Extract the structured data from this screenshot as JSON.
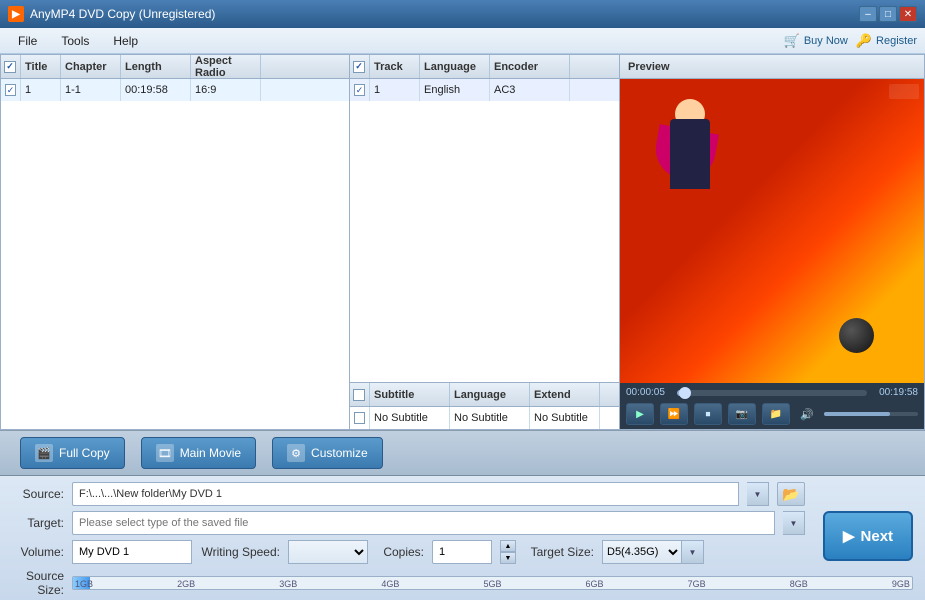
{
  "titleBar": {
    "appName": "AnyMP4 DVD Copy (Unregistered)",
    "minBtn": "–",
    "maxBtn": "□",
    "closeBtn": "✕"
  },
  "menuBar": {
    "items": [
      "File",
      "Tools",
      "Help"
    ]
  },
  "topActions": {
    "buyLabel": "Buy Now",
    "registerLabel": "Register"
  },
  "mainTable": {
    "headers": [
      {
        "label": "",
        "check": true
      },
      {
        "label": "Title"
      },
      {
        "label": "Chapter"
      },
      {
        "label": "Length"
      },
      {
        "label": "Aspect Radio"
      }
    ],
    "rows": [
      {
        "check": true,
        "title": "1",
        "chapter": "1-1",
        "length": "00:19:58",
        "aspect": "16:9"
      }
    ]
  },
  "audioTable": {
    "headers": [
      {
        "label": "",
        "check": true
      },
      {
        "label": "Track"
      },
      {
        "label": "Language"
      },
      {
        "label": "Encoder"
      }
    ],
    "rows": [
      {
        "check": true,
        "track": "1",
        "language": "English",
        "encoder": "AC3"
      }
    ]
  },
  "subtitleTable": {
    "headers": [
      {
        "label": "",
        "check": true
      },
      {
        "label": "Subtitle"
      },
      {
        "label": "Language"
      },
      {
        "label": "Extend"
      }
    ],
    "rows": [
      {
        "check": false,
        "subtitle": "No Subtitle",
        "language": "No Subtitle",
        "extend": "No Subtitle"
      }
    ]
  },
  "preview": {
    "label": "Preview",
    "timeStart": "00:00:05",
    "timeEnd": "00:19:58"
  },
  "actionButtons": {
    "fullCopy": "Full Copy",
    "mainMovie": "Main Movie",
    "customize": "Customize"
  },
  "form": {
    "sourceLabel": "Source:",
    "sourceValue": "F:\\...\\...\\New folder\\My DVD 1",
    "targetLabel": "Target:",
    "targetPlaceholder": "Please select type of the saved file",
    "volumeLabel": "Volume:",
    "volumeValue": "My DVD 1",
    "writingSpeedLabel": "Writing Speed:",
    "copiesLabel": "Copies:",
    "copiesValue": "1",
    "targetSizeLabel": "Target Size:",
    "targetSizeValue": "D5(4.35G)",
    "sourceSizeLabel": "Source Size:",
    "sizeMarkers": [
      "1GB",
      "2GB",
      "3GB",
      "4GB",
      "5GB",
      "6GB",
      "7GB",
      "8GB",
      "9GB"
    ]
  },
  "nextButton": {
    "label": "Next",
    "icon": "▶"
  }
}
